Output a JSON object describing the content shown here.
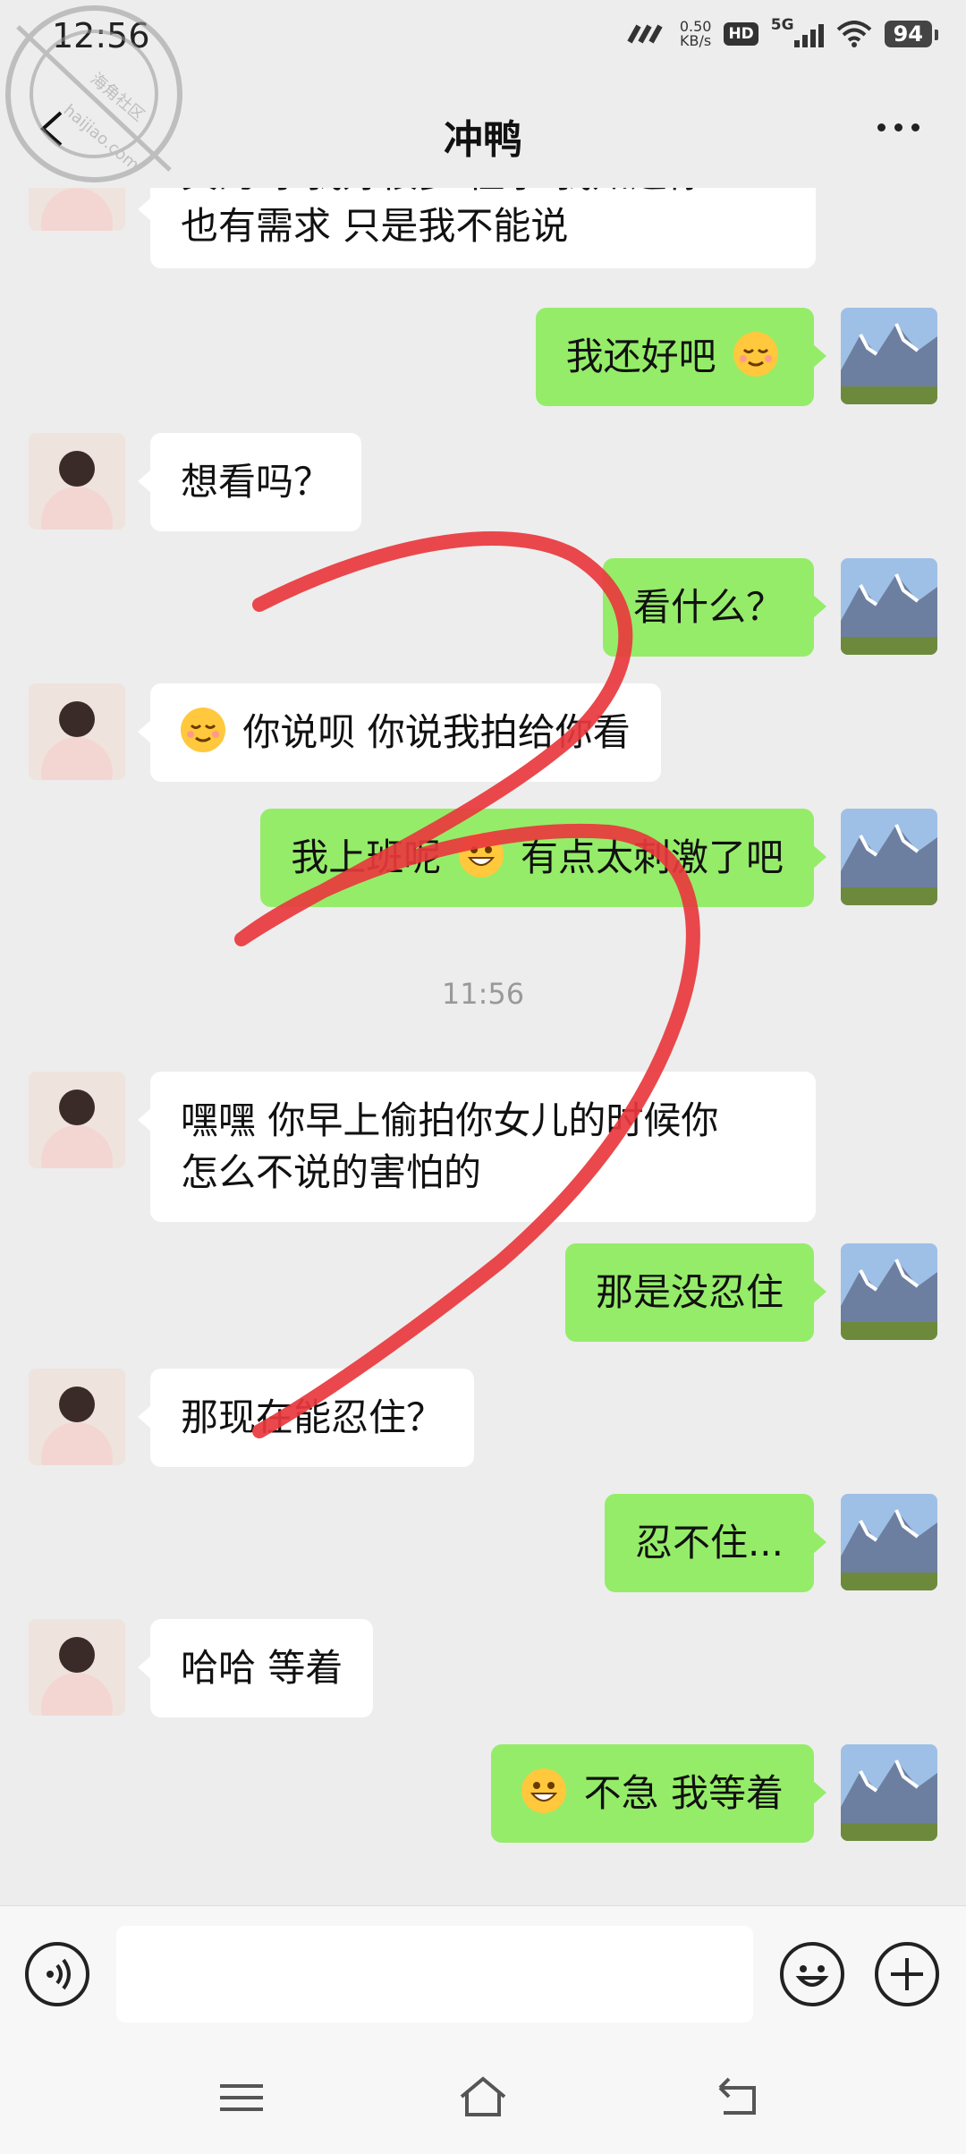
{
  "status_bar": {
    "time": "12:56",
    "net_speed_value": "0.50",
    "net_speed_unit": "KB/s",
    "hd_label": "HD",
    "network_type": "5G",
    "battery": "94"
  },
  "header": {
    "title": "冲鸭",
    "back_icon": "chevron-left-icon",
    "more_icon": "more-dots-icon"
  },
  "watermark": {
    "lines": [
      "海角社区",
      "haijiao.com"
    ]
  },
  "messages": [
    {
      "side": "in",
      "text": "真的呀 我好很多 性求 我知道你"
    },
    {
      "side": "in",
      "text": "也有需求  只是我不能说"
    },
    {
      "side": "out",
      "text": "我还好吧",
      "emoji": "relieved-face-icon"
    },
    {
      "side": "in",
      "text": "想看吗？"
    },
    {
      "side": "out",
      "text": "看什么？"
    },
    {
      "side": "in",
      "emoji": "relieved-face-icon",
      "text": "你说呗  你说我拍给你看"
    },
    {
      "side": "out",
      "text_before": "我上班呢",
      "emoji": "grin-face-icon",
      "text_after": "有点太刺激了吧"
    },
    {
      "side": "time",
      "text": "11:56"
    },
    {
      "side": "in",
      "text": "嘿嘿  你早上偷拍你女儿的时候你"
    },
    {
      "side": "in",
      "text": "怎么不说的害怕的"
    },
    {
      "side": "out",
      "text": "那是没忍住"
    },
    {
      "side": "in",
      "text": "那现在能忍住？"
    },
    {
      "side": "out",
      "text": "忍不住..."
    },
    {
      "side": "in",
      "text": "哈哈 等着"
    },
    {
      "side": "out",
      "emoji": "grin-face-icon",
      "text": "不急  我等着"
    }
  ],
  "input_bar": {
    "voice_icon": "voice-icon",
    "emoji_icon": "smile-icon",
    "plus_icon": "plus-icon",
    "placeholder": ""
  },
  "nav_bar": {
    "icons": [
      "menu-icon",
      "home-icon",
      "back-icon"
    ]
  },
  "colors": {
    "background": "#ededed",
    "outgoing_bubble": "#95ec69",
    "incoming_bubble": "#ffffff",
    "scribble": "#e8383d"
  }
}
